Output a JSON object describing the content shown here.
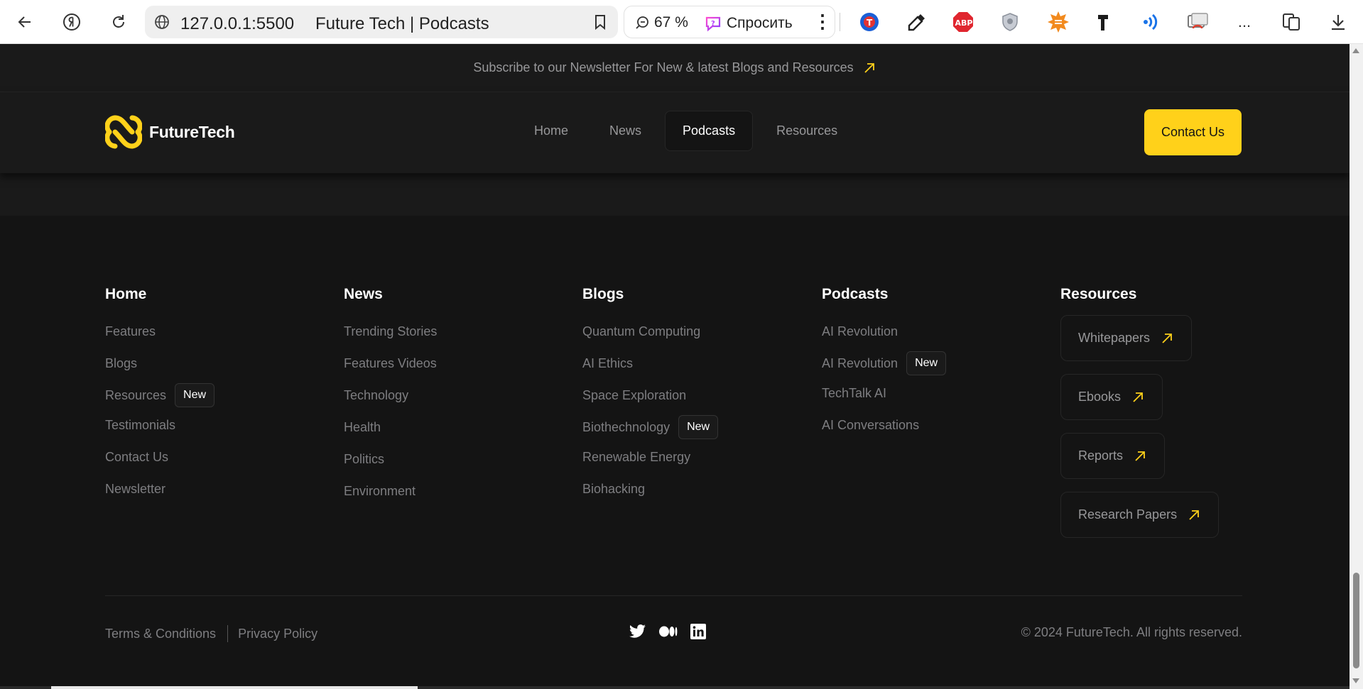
{
  "browser": {
    "url": "127.0.0.1:5500",
    "page_title": "Future Tech | Podcasts",
    "zoom": "67 %",
    "ask_label": "Спросить",
    "more_label": "..."
  },
  "topbar": {
    "text": "Subscribe to our Newsletter For New & latest Blogs and Resources"
  },
  "nav": {
    "logo_name": "FutureTech",
    "links": [
      "Home",
      "News",
      "Podcasts",
      "Resources"
    ],
    "active": "Podcasts",
    "contact_label": "Contact Us"
  },
  "footer": {
    "columns": [
      {
        "title": "Home",
        "items": [
          {
            "label": "Features",
            "badge": null
          },
          {
            "label": "Blogs",
            "badge": null
          },
          {
            "label": "Resources",
            "badge": "New"
          },
          {
            "label": "Testimonials",
            "badge": null
          },
          {
            "label": "Contact Us",
            "badge": null
          },
          {
            "label": "Newsletter",
            "badge": null
          }
        ]
      },
      {
        "title": "News",
        "items": [
          {
            "label": "Trending Stories",
            "badge": null
          },
          {
            "label": "Features Videos",
            "badge": null
          },
          {
            "label": "Technology",
            "badge": null
          },
          {
            "label": "Health",
            "badge": null
          },
          {
            "label": "Politics",
            "badge": null
          },
          {
            "label": "Environment",
            "badge": null
          }
        ]
      },
      {
        "title": "Blogs",
        "items": [
          {
            "label": "Quantum Computing",
            "badge": null
          },
          {
            "label": "AI Ethics",
            "badge": null
          },
          {
            "label": "Space Exploration",
            "badge": null
          },
          {
            "label": "Biothechnology",
            "badge": "New"
          },
          {
            "label": "Renewable Energy",
            "badge": null
          },
          {
            "label": "Biohacking",
            "badge": null
          }
        ]
      },
      {
        "title": "Podcasts",
        "items": [
          {
            "label": "AI Revolution",
            "badge": null
          },
          {
            "label": "AI Revolution",
            "badge": "New"
          },
          {
            "label": "TechTalk AI",
            "badge": null
          },
          {
            "label": "AI Conversations",
            "badge": null
          }
        ]
      },
      {
        "title": "Resources",
        "items": [
          {
            "label": "Whitepapers"
          },
          {
            "label": "Ebooks"
          },
          {
            "label": "Reports"
          },
          {
            "label": "Research Papers"
          }
        ]
      }
    ],
    "terms": "Terms & Conditions",
    "privacy": "Privacy Policy",
    "socials": [
      "twitter-icon",
      "medium-icon",
      "linkedin-icon"
    ],
    "copyright": "© 2024 FutureTech. All rights reserved."
  },
  "colors": {
    "accent": "#ffd11a",
    "background": "#141414",
    "surface": "#1a1a1a",
    "muted_text": "#7e7e81",
    "border": "#262626"
  }
}
